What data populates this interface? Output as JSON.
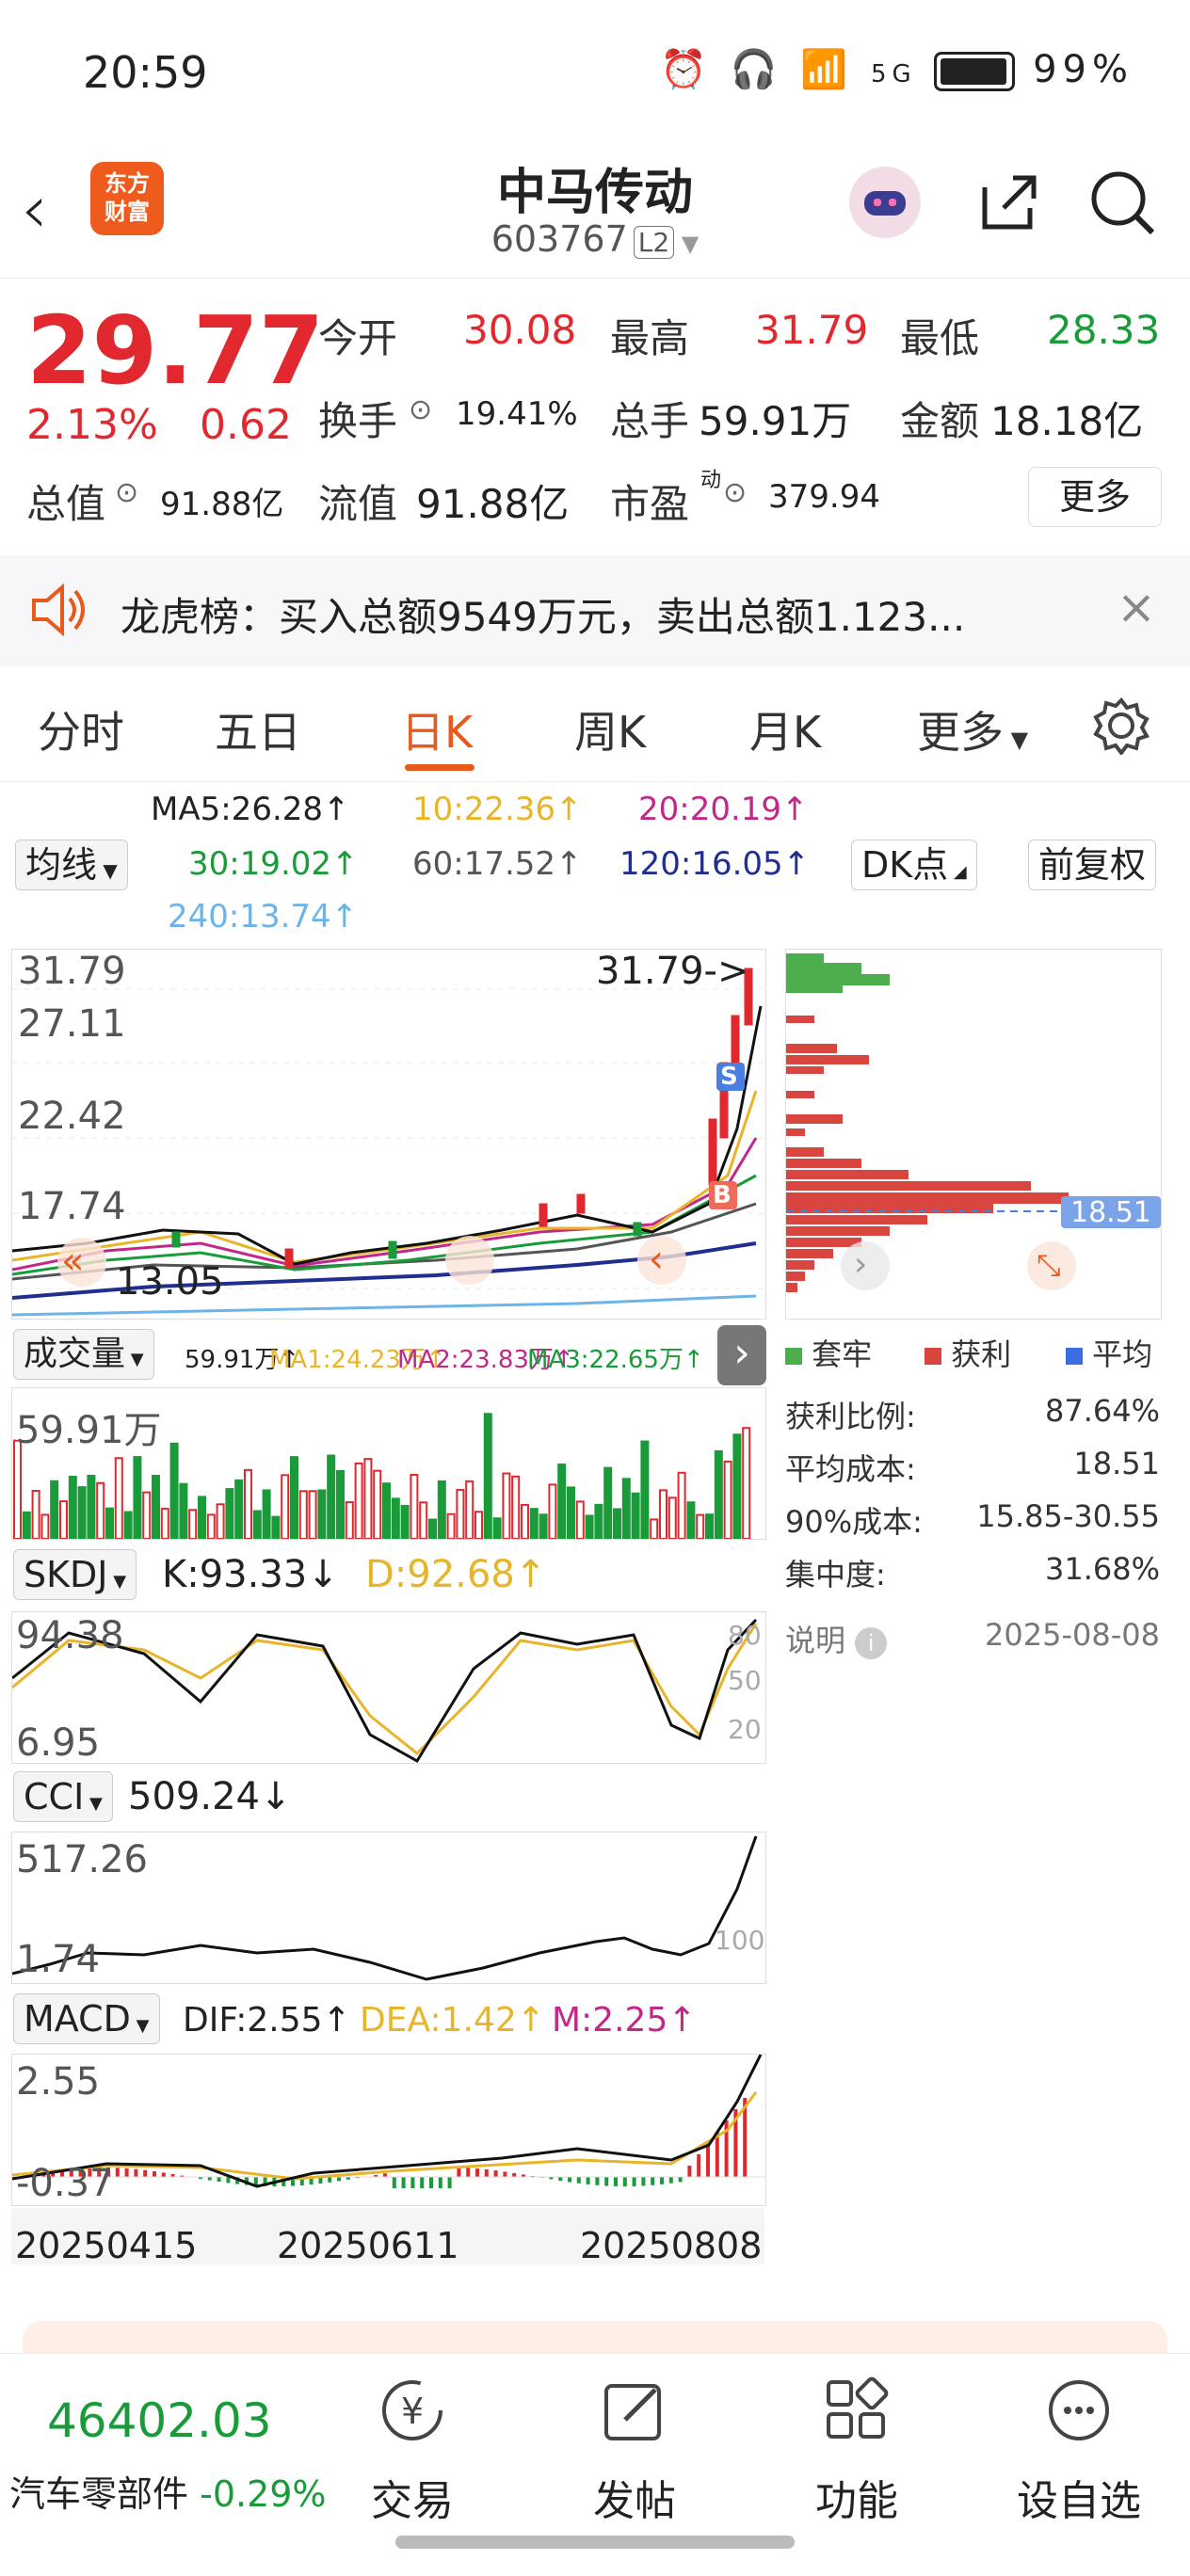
{
  "status": {
    "time": "20:59",
    "battery": "99%",
    "network": "5G"
  },
  "header": {
    "brand_line1": "东方",
    "brand_line2": "财富",
    "title": "中马传动",
    "code": "603767",
    "level": "L2"
  },
  "quote": {
    "price": "29.77",
    "pct": "2.13%",
    "change": "0.62",
    "open_label": "今开",
    "open": "30.08",
    "high_label": "最高",
    "high": "31.79",
    "low_label": "最低",
    "low": "28.33",
    "turnover_label": "换手",
    "turnover": "19.41%",
    "vol_label": "总手",
    "vol": "59.91万",
    "amount_label": "金额",
    "amount": "18.18亿",
    "mktcap_label": "总值",
    "mktcap": "91.88亿",
    "float_label": "流值",
    "float": "91.88亿",
    "pe_label": "市盈",
    "pe_sup": "动",
    "pe": "379.94",
    "more": "更多"
  },
  "notice": {
    "text": "龙虎榜：买入总额9549万元，卖出总额1.123..."
  },
  "tabs": [
    "分时",
    "五日",
    "日K",
    "周K",
    "月K",
    "更多"
  ],
  "ma": {
    "button": "均线",
    "ma5": "MA5:26.28↑",
    "ma10": "10:22.36↑",
    "ma20": "20:20.19↑",
    "ma30": "30:19.02↑",
    "ma60": "60:17.52↑",
    "ma120": "120:16.05↑",
    "ma240": "240:13.74↑",
    "dk": "DK点",
    "adjust": "前复权"
  },
  "kline": {
    "y_top": "31.79",
    "y2": "27.11",
    "y3": "22.42",
    "y4": "17.74",
    "y_bottom": "13.05",
    "high_marker": "31.79->",
    "low_marker": "13.05",
    "cost_label": "18.51"
  },
  "volume": {
    "button": "成交量",
    "v": "59.91万↑",
    "ma1": "MA1:24.23万↑",
    "ma2": "MA2:23.83万↑",
    "ma3": "MA3:22.65万↑",
    "axis": "59.91万"
  },
  "skdj": {
    "button": "SKDJ",
    "k": "K:93.33↓",
    "d": "D:92.68↑",
    "top": "94.38",
    "bottom": "6.95",
    "l80": "80",
    "l50": "50",
    "l20": "20"
  },
  "cci": {
    "button": "CCI",
    "v": "509.24↓",
    "top": "517.26",
    "bottom": "1.74",
    "l100": "100"
  },
  "macd": {
    "button": "MACD",
    "dif": "DIF:2.55↑",
    "dea": "DEA:1.42↑",
    "m": "M:2.25↑",
    "top": "2.55",
    "bottom": "-0.37"
  },
  "dates": [
    "20250415",
    "20250611",
    "20250808"
  ],
  "chips": {
    "legend": [
      "套牢",
      "获利",
      "平均"
    ],
    "profit_label": "获利比例:",
    "profit": "87.64%",
    "avg_label": "平均成本:",
    "avg": "18.51",
    "c90_label": "90%成本:",
    "c90": "15.85-30.55",
    "conc_label": "集中度:",
    "conc": "31.68%",
    "note_label": "说明",
    "date": "2025-08-08"
  },
  "bottom": {
    "index_value": "46402.03",
    "sector": "汽车零部件",
    "sector_pct": "-0.29%",
    "trade": "交易",
    "post": "发帖",
    "func": "功能",
    "watch": "设自选"
  },
  "colors": {
    "up": "#e0282e",
    "down": "#1a9b3a",
    "accent": "#e85a1c"
  }
}
